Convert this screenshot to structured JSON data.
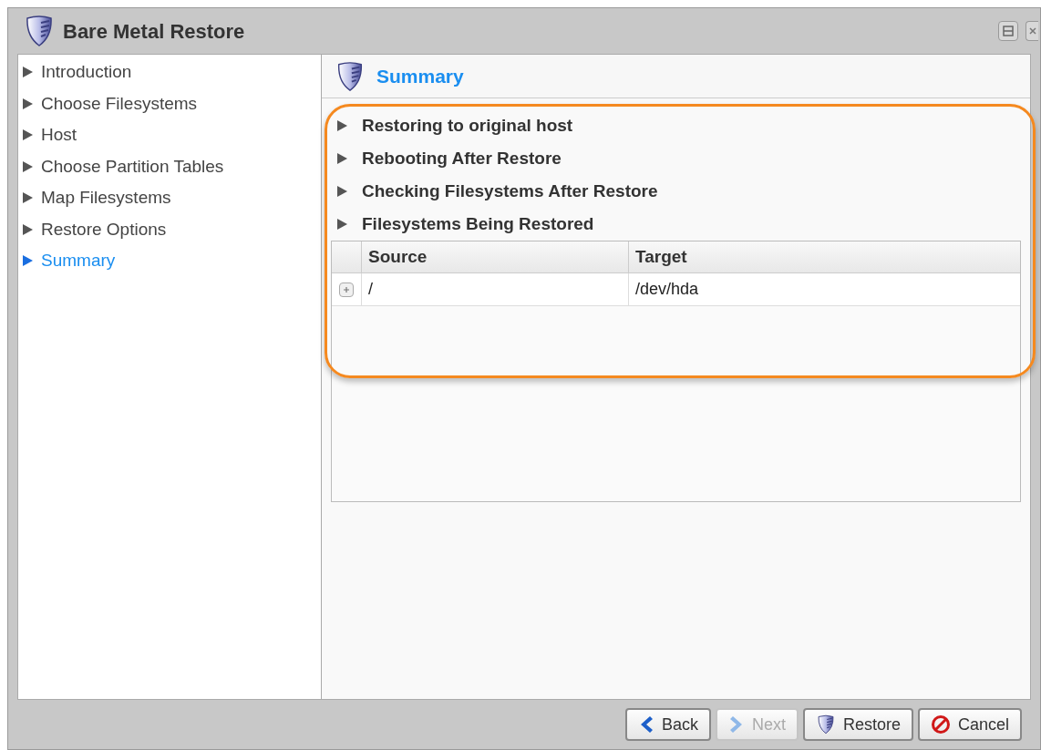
{
  "window": {
    "title": "Bare Metal Restore"
  },
  "steps": [
    {
      "label": "Introduction",
      "selected": false
    },
    {
      "label": "Choose Filesystems",
      "selected": false
    },
    {
      "label": "Host",
      "selected": false
    },
    {
      "label": "Choose Partition Tables",
      "selected": false
    },
    {
      "label": "Map Filesystems",
      "selected": false
    },
    {
      "label": "Restore Options",
      "selected": false
    },
    {
      "label": "Summary",
      "selected": true
    }
  ],
  "panel": {
    "title": "Summary"
  },
  "sections": [
    {
      "label": "Restoring to original host",
      "expanded": false
    },
    {
      "label": "Rebooting After Restore",
      "expanded": false
    },
    {
      "label": "Checking Filesystems After Restore",
      "expanded": false
    },
    {
      "label": "Filesystems Being Restored",
      "expanded": false
    }
  ],
  "table": {
    "columns": [
      "Source",
      "Target"
    ],
    "rows": [
      {
        "expanded": false,
        "cells": [
          "/",
          "/dev/hda"
        ]
      }
    ]
  },
  "buttons": [
    {
      "label": "Back",
      "kind": "back",
      "disabled": false
    },
    {
      "label": "Next",
      "kind": "next",
      "disabled": true
    },
    {
      "label": "Restore",
      "kind": "restore",
      "disabled": false
    },
    {
      "label": "Cancel",
      "kind": "cancel",
      "disabled": false
    }
  ]
}
